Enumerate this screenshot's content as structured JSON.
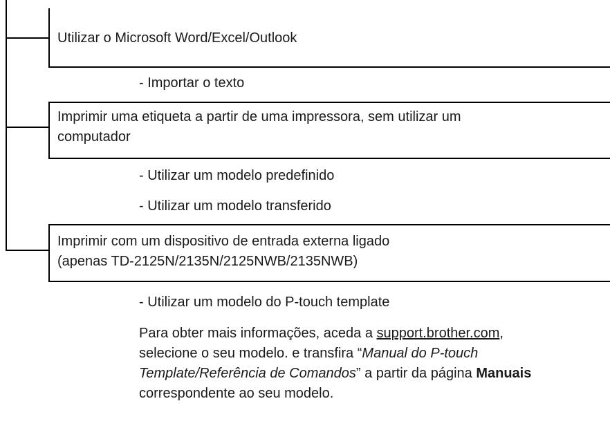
{
  "sections": [
    {
      "title_lines": [
        "Utilizar o Microsoft Word/Excel/Outlook"
      ],
      "items": [
        "- Importar o texto"
      ]
    },
    {
      "title_lines": [
        "Imprimir uma etiqueta a partir de uma impressora, sem utilizar um",
        "computador"
      ],
      "items": [
        "- Utilizar um modelo predefinido",
        "- Utilizar um modelo transferido"
      ]
    },
    {
      "title_lines": [
        "Imprimir com um dispositivo de entrada externa ligado",
        "(apenas TD-2125N/2135N/2125NWB/2135NWB)"
      ],
      "items": [
        "- Utilizar um modelo do P-touch template"
      ]
    }
  ],
  "note": {
    "part1": "Para obter mais informações, aceda a ",
    "link": "support.brother.com",
    "part2": ", selecione o seu modelo. e transfira ",
    "open_quote": "“",
    "manual_title": "Manual do P-touch Template/Referência de Comandos",
    "close_quote": "”",
    "part3": " a partir da página ",
    "bold_word": "Manuais",
    "part4": " correspondente ao seu modelo."
  }
}
